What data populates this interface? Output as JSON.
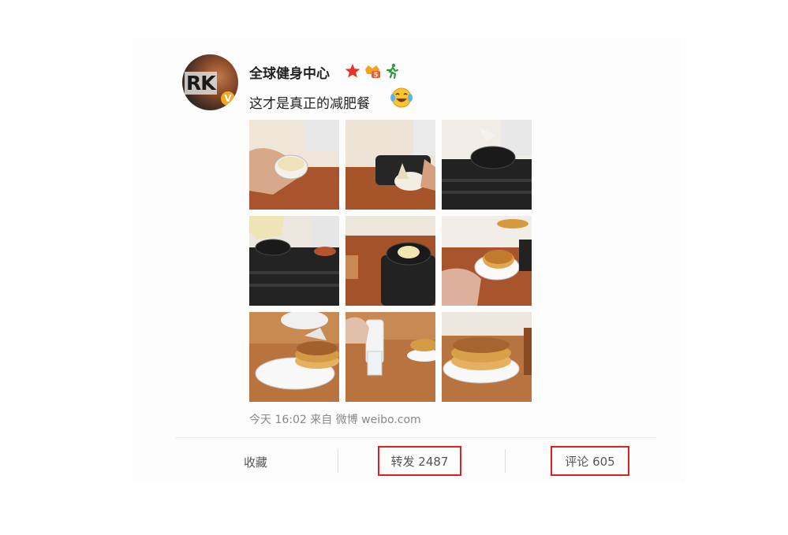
{
  "post": {
    "author": "全球健身中心",
    "text": "这才是真正的减肥餐",
    "avatar_text": "RK",
    "avatar_badge": "V",
    "icons": [
      "red-star-icon",
      "level-badge-icon",
      "runner-icon"
    ],
    "emoji": "laughing-tears-emoji-icon",
    "meta": "今天 16:02 来自 微博 weibo.com"
  },
  "actions": {
    "favorite": "收藏",
    "repost": "转发 2487",
    "comment": "评论 605"
  },
  "colors": {
    "highlight": "#e02020",
    "text": "#222222",
    "muted": "#888888"
  }
}
